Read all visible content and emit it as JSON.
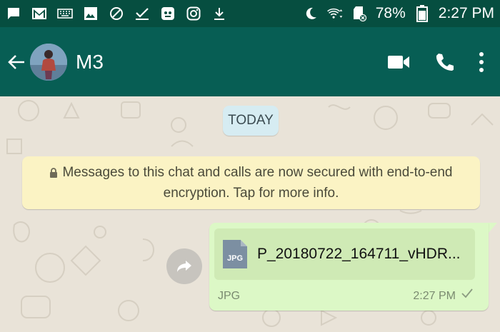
{
  "status_bar": {
    "battery_percent": "78%",
    "time": "2:27 PM",
    "icons": [
      "chat-icon",
      "gmail-icon",
      "keyboard-icon",
      "image-icon",
      "blocked-icon",
      "check-icon",
      "bot-icon",
      "instagram-icon",
      "download-icon",
      "moon-icon",
      "wifi-icon",
      "sd-card-icon",
      "battery-icon"
    ]
  },
  "header": {
    "contact_name": "M3",
    "actions": [
      "video-call-icon",
      "voice-call-icon",
      "more-options-icon"
    ]
  },
  "chat": {
    "date_chip": "TODAY",
    "encryption_notice": "Messages to this chat and calls are now secured with end-to-end encryption. Tap for more info.",
    "message": {
      "file_name": "P_20180722_164711_vHDR...",
      "file_icon_label": "JPG",
      "file_type": "JPG",
      "time": "2:27 PM",
      "status": "sent"
    }
  },
  "colors": {
    "header": "#075e54",
    "status_bar": "#064e40",
    "bubble": "#dcf8c6",
    "notice": "#fbf3c4",
    "date_chip": "#d6ecf2"
  }
}
